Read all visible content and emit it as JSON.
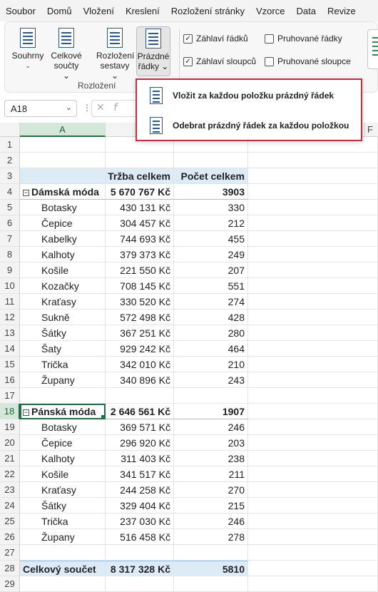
{
  "menu_tabs": [
    "Soubor",
    "Domů",
    "Vložení",
    "Kreslení",
    "Rozložení stránky",
    "Vzorce",
    "Data",
    "Revize"
  ],
  "ribbon": {
    "buttons": [
      {
        "line1": "Souhrny",
        "line2": "⌄"
      },
      {
        "line1": "Celkové",
        "line2": "součty ⌄"
      },
      {
        "line1": "Rozložení",
        "line2": "sestavy ⌄"
      },
      {
        "line1": "Prázdné",
        "line2": "řádky ⌄"
      }
    ],
    "group_label": "Rozložení",
    "checkboxes": [
      {
        "label": "Záhlaví řádků",
        "checked": true
      },
      {
        "label": "Pruhované řádky",
        "checked": false
      },
      {
        "label": "Záhlaví sloupců",
        "checked": true
      },
      {
        "label": "Pruhované sloupce",
        "checked": false
      }
    ],
    "check_mark": "✓"
  },
  "dropdown": {
    "items": [
      "Vložit za každou položku prázdný řádek",
      "Odebrat prázdný řádek za každou položkou"
    ]
  },
  "formula_bar": {
    "name_box": "A18",
    "cancel_icon": "✕",
    "fx": "f"
  },
  "columns": {
    "A": "A",
    "F": "F"
  },
  "table": {
    "header": {
      "b": "Tržba celkem",
      "c": "Počet celkem"
    },
    "groups": [
      {
        "name": "Dámská móda",
        "sales": "5 670 767 Kč",
        "count": "3903",
        "items": [
          {
            "name": "Botasky",
            "sales": "430 131 Kč",
            "count": "330"
          },
          {
            "name": "Čepice",
            "sales": "304 457 Kč",
            "count": "212"
          },
          {
            "name": "Kabelky",
            "sales": "744 693 Kč",
            "count": "455"
          },
          {
            "name": "Kalhoty",
            "sales": "379 373 Kč",
            "count": "249"
          },
          {
            "name": "Košile",
            "sales": "221 550 Kč",
            "count": "207"
          },
          {
            "name": "Kozačky",
            "sales": "708 145 Kč",
            "count": "551"
          },
          {
            "name": "Kraťasy",
            "sales": "330 520 Kč",
            "count": "274"
          },
          {
            "name": "Sukně",
            "sales": "572 498 Kč",
            "count": "428"
          },
          {
            "name": "Šátky",
            "sales": "367 251 Kč",
            "count": "280"
          },
          {
            "name": "Šaty",
            "sales": "929 242 Kč",
            "count": "464"
          },
          {
            "name": "Trička",
            "sales": "342 010 Kč",
            "count": "210"
          },
          {
            "name": "Župany",
            "sales": "340 896 Kč",
            "count": "243"
          }
        ]
      },
      {
        "name": "Pánská móda",
        "sales": "2 646 561 Kč",
        "count": "1907",
        "items": [
          {
            "name": "Botasky",
            "sales": "369 571 Kč",
            "count": "246"
          },
          {
            "name": "Čepice",
            "sales": "296 920 Kč",
            "count": "203"
          },
          {
            "name": "Kalhoty",
            "sales": "311 403 Kč",
            "count": "238"
          },
          {
            "name": "Košile",
            "sales": "341 517 Kč",
            "count": "211"
          },
          {
            "name": "Kraťasy",
            "sales": "244 258 Kč",
            "count": "270"
          },
          {
            "name": "Šátky",
            "sales": "329 404 Kč",
            "count": "215"
          },
          {
            "name": "Trička",
            "sales": "237 030 Kč",
            "count": "246"
          },
          {
            "name": "Župany",
            "sales": "516 458 Kč",
            "count": "278"
          }
        ]
      }
    ],
    "total": {
      "name": "Celkový součet",
      "sales": "8 317 328 Kč",
      "count": "5810"
    }
  },
  "row_numbers": [
    "1",
    "2",
    "3",
    "4",
    "5",
    "6",
    "7",
    "8",
    "9",
    "10",
    "11",
    "12",
    "13",
    "14",
    "15",
    "16",
    "17",
    "18",
    "19",
    "20",
    "21",
    "22",
    "23",
    "24",
    "25",
    "26",
    "27",
    "28",
    "29"
  ],
  "toggle_glyph": "⊟",
  "accent": "#1e7145",
  "highlight_border": "#d1283a"
}
